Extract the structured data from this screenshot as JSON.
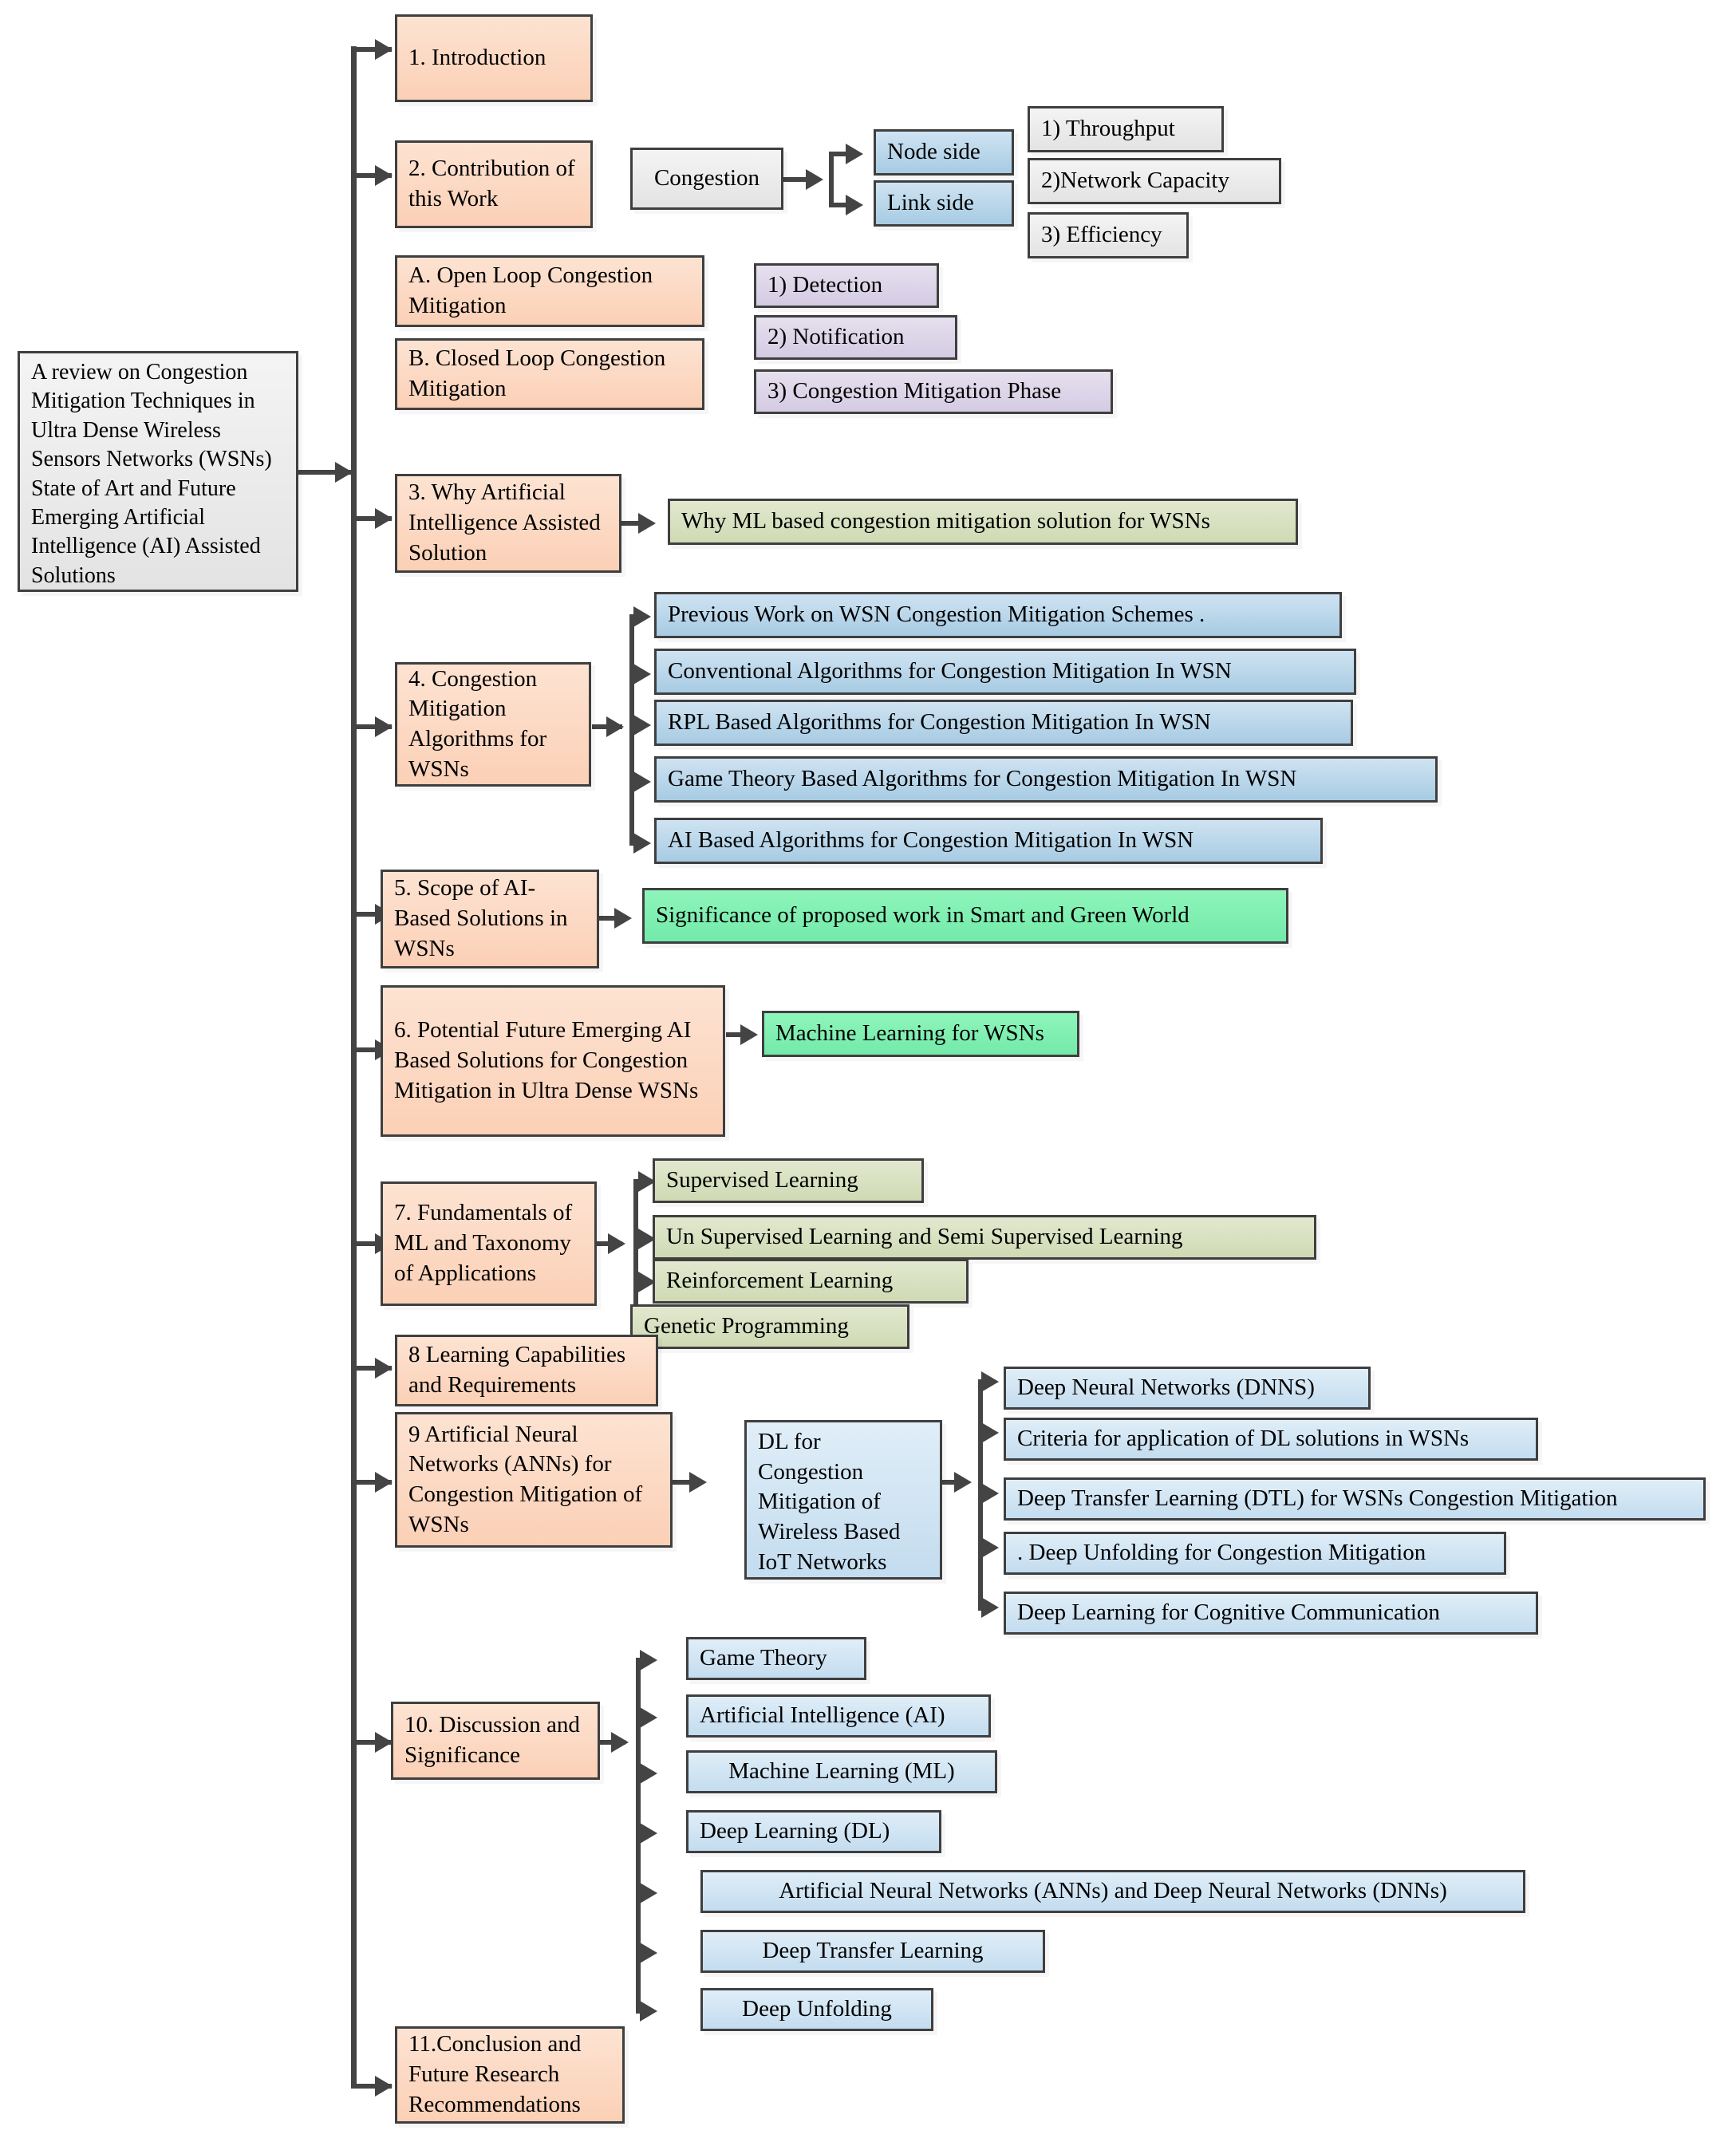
{
  "diagram": {
    "title": "A review on Congestion Mitigation Techniques in Ultra Dense Wireless Sensors Networks (WSNs) State of Art and Future Emerging Artificial Intelligence (AI) Assisted Solutions",
    "root": {
      "label": "A review on Congestion Mitigation Techniques in Ultra Dense Wireless Sensors Networks (WSNs) State of Art and Future Emerging Artificial Intelligence (AI) Assisted Solutions"
    },
    "sections": [
      {
        "id": "s1",
        "label": "1. Introduction"
      },
      {
        "id": "s2",
        "label": "2. Contribution of this Work"
      },
      {
        "id": "s2a",
        "label": "A. Open Loop Congestion Mitigation"
      },
      {
        "id": "s2b",
        "label": "B. Closed Loop Congestion Mitigation"
      },
      {
        "id": "s3",
        "label": "3. Why Artificial Intelligence Assisted Solution"
      },
      {
        "id": "s4",
        "label": "4. Congestion Mitigation Algorithms for WSNs"
      },
      {
        "id": "s5",
        "label": "5. Scope of AI-Based Solutions in WSNs"
      },
      {
        "id": "s6",
        "label": "6. Potential Future Emerging AI Based Solutions for Congestion Mitigation in Ultra Dense WSNs"
      },
      {
        "id": "s7",
        "label": "7. Fundamentals of ML and Taxonomy of Applications"
      },
      {
        "id": "s8",
        "label": "8 Learning Capabilities and Requirements"
      },
      {
        "id": "s9",
        "label": "9 Artificial Neural Networks (ANNs) for Congestion Mitigation of WSNs"
      },
      {
        "id": "s10",
        "label": "10. Discussion and Significance"
      },
      {
        "id": "s11",
        "label": "11.Conclusion and Future Research Recommendations"
      }
    ],
    "congestion": {
      "label": "Congestion",
      "sides": [
        {
          "label": "Node side"
        },
        {
          "label": "Link side"
        }
      ],
      "metrics": [
        {
          "label": "1) Throughput"
        },
        {
          "label": "2)Network Capacity"
        },
        {
          "label": "3) Efficiency"
        }
      ]
    },
    "loop_phases": [
      {
        "label": "1) Detection"
      },
      {
        "label": "2) Notification"
      },
      {
        "label": "3) Congestion Mitigation Phase"
      }
    ],
    "why_ai": {
      "label": "Why ML based congestion mitigation solution for WSNs"
    },
    "algorithms": [
      {
        "label": "Previous Work on WSN Congestion Mitigation Schemes ."
      },
      {
        "label": "Conventional Algorithms for Congestion Mitigation In WSN"
      },
      {
        "label": "RPL Based Algorithms for Congestion Mitigation In WSN"
      },
      {
        "label": "Game Theory Based Algorithms for Congestion Mitigation In WSN"
      },
      {
        "label": "AI Based Algorithms for Congestion Mitigation In WSN"
      }
    ],
    "significance": {
      "label": "Significance of proposed work in Smart and Green World"
    },
    "machine_learning_wsn": {
      "label": "Machine Learning for WSNs"
    },
    "ml_taxonomy": [
      {
        "label": "Supervised Learning"
      },
      {
        "label": "Un Supervised Learning and Semi Supervised Learning"
      },
      {
        "label": "Reinforcement Learning"
      },
      {
        "label": "Genetic Programming"
      }
    ],
    "dl_hub": {
      "label": "DL for Congestion Mitigation of Wireless Based IoT Networks"
    },
    "dl_topics": [
      {
        "label": "Deep Neural Networks (DNNS)"
      },
      {
        "label": "Criteria for application of DL solutions in WSNs"
      },
      {
        "label": "Deep Transfer Learning (DTL) for WSNs Congestion Mitigation"
      },
      {
        "label": ". Deep Unfolding for Congestion Mitigation"
      },
      {
        "label": "Deep Learning for Cognitive Communication"
      }
    ],
    "discussion_topics": [
      {
        "label": "Game Theory"
      },
      {
        "label": "Artificial Intelligence (AI)"
      },
      {
        "label": "Machine Learning (ML)"
      },
      {
        "label": "Deep Learning (DL)"
      },
      {
        "label": "Artificial Neural Networks (ANNs) and Deep Neural  Networks (DNNs)"
      },
      {
        "label": "Deep Transfer Learning"
      },
      {
        "label": "Deep Unfolding"
      }
    ],
    "colors": {
      "section_box": "#fbd0b6",
      "grey_box": "#e8e8e8",
      "blue_box": "#a7cbe3",
      "blue_light_box": "#c3dcef",
      "purple_box": "#d4cbe3",
      "olive_box": "#cfdab4",
      "green_box": "#73eaa9",
      "connector": "#444444",
      "border": "#3f3f3f"
    }
  }
}
